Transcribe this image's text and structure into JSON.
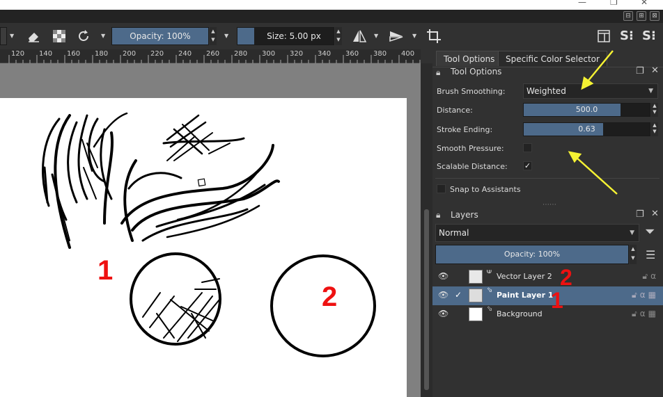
{
  "window": {
    "min_glyph": "—",
    "max_glyph": "❐",
    "close_glyph": "✕"
  },
  "toolbar": {
    "opacity_label": "Opacity: 100%",
    "opacity_value": 1.0,
    "size_label": "Size: 5.00 px"
  },
  "ruler": {
    "ticks": [
      "120",
      "140",
      "160",
      "180",
      "200",
      "220",
      "240",
      "260",
      "280",
      "300",
      "320",
      "340",
      "360",
      "380",
      "400"
    ]
  },
  "canvas": {
    "annotation_1": "1",
    "annotation_2": "2"
  },
  "docker": {
    "tabs": [
      "Tool Options",
      "Specific Color Selector"
    ],
    "tool_options": {
      "title": "Tool Options",
      "brush_smoothing_label": "Brush Smoothing:",
      "brush_smoothing_value": "Weighted",
      "distance_label": "Distance:",
      "distance_value": "500.0",
      "distance_fraction": 0.77,
      "stroke_ending_label": "Stroke Ending:",
      "stroke_ending_value": "0.63",
      "stroke_ending_fraction": 0.63,
      "smooth_pressure_label": "Smooth Pressure:",
      "smooth_pressure_checked": false,
      "scalable_distance_label": "Scalable Distance:",
      "scalable_distance_checked": true,
      "snap_label": "Snap to Assistants",
      "snap_checked": false,
      "check_glyph": "✓"
    },
    "layers": {
      "title": "Layers",
      "blend_mode": "Normal",
      "opacity_label": "Opacity:  100%",
      "opacity_value": 1.0,
      "rows": [
        {
          "name": "Vector Layer 2",
          "selected": false,
          "checked": false,
          "annotation": "2"
        },
        {
          "name": "Paint Layer 1",
          "selected": true,
          "checked": true,
          "annotation": "1"
        },
        {
          "name": "Background",
          "selected": false,
          "checked": false,
          "annotation": ""
        }
      ]
    }
  },
  "colors": {
    "accent": "#4d6a8a",
    "annotation_red": "#ee1111",
    "arrow_yellow": "#f5f233"
  }
}
